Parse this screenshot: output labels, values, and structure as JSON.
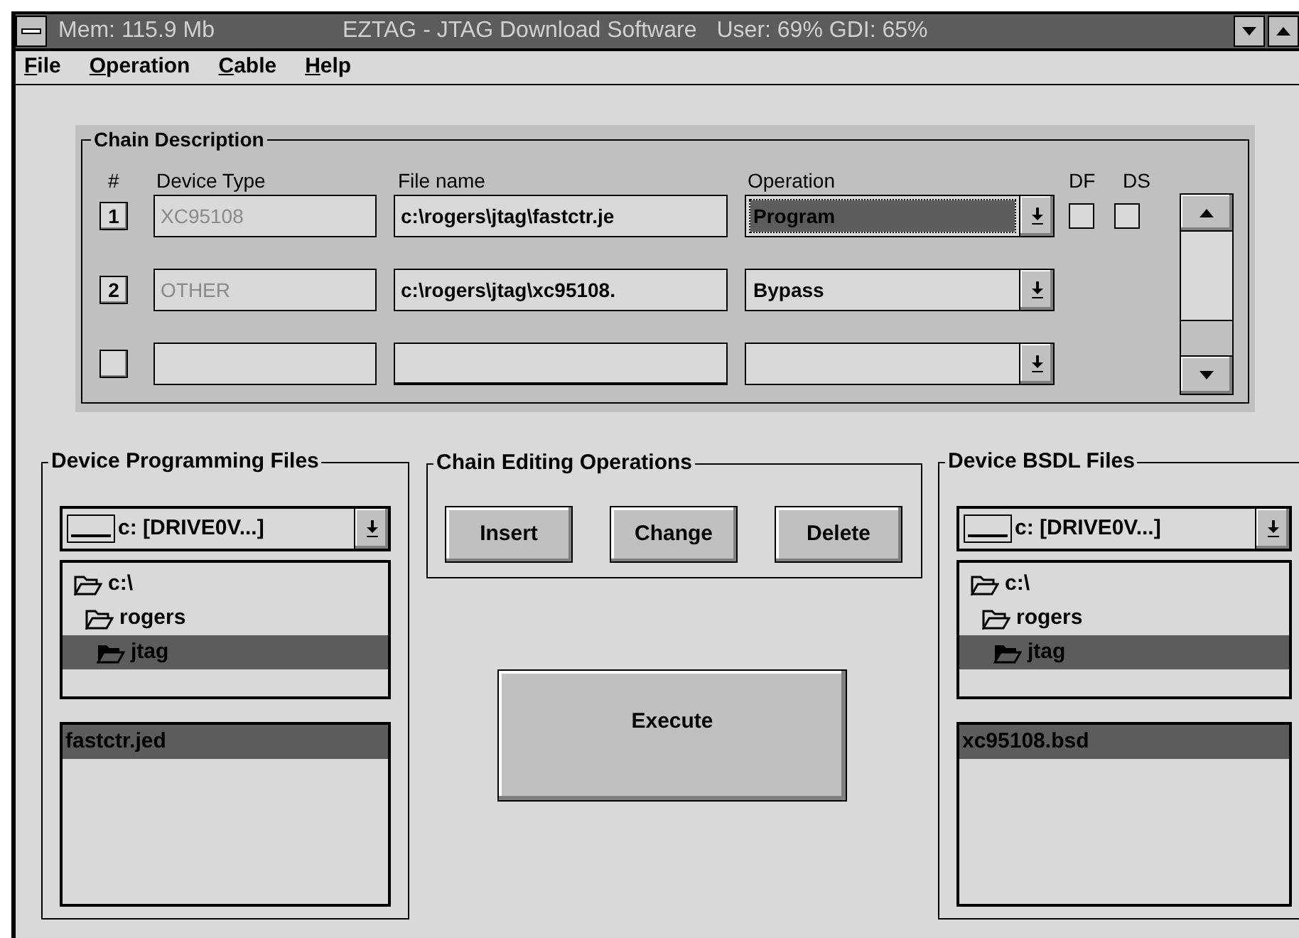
{
  "window": {
    "memory": "Mem: 115.9 Mb",
    "title": "EZTAG - JTAG Download Software",
    "resources": "User: 69% GDI: 65%"
  },
  "menu": [
    {
      "label": "File"
    },
    {
      "label": "Operation"
    },
    {
      "label": "Cable"
    },
    {
      "label": "Help"
    }
  ],
  "chain_description": {
    "title": "Chain Description",
    "columns": {
      "number": "#",
      "device_type": "Device Type",
      "file_name": "File name",
      "operation": "Operation",
      "df": "DF",
      "ds": "DS"
    },
    "rows": [
      {
        "number": "1",
        "device_type": "XC95108",
        "file_name": "c:\\rogers\\jtag\\fastctr.je",
        "operation": "Program",
        "selected": true,
        "df_checked": false,
        "ds_checked": false
      },
      {
        "number": "2",
        "device_type": "OTHER",
        "file_name": "c:\\rogers\\jtag\\xc95108.",
        "operation": "Bypass",
        "selected": false
      },
      {
        "selected": false
      }
    ]
  },
  "programming_files": {
    "title": "Device Programming Files",
    "drive": "c: [DRIVE0V...]",
    "folders": [
      {
        "label": "c:\\",
        "selected": false,
        "children": [
          {
            "label": "rogers",
            "selected": false,
            "children": [
              {
                "label": "jtag",
                "selected": true
              }
            ]
          }
        ]
      }
    ],
    "files": [
      {
        "label": "fastctr.jed",
        "selected": true
      }
    ]
  },
  "chain_editing": {
    "title": "Chain Editing Operations",
    "buttons": [
      "Insert",
      "Change",
      "Delete"
    ]
  },
  "execute_button": "Execute",
  "bsdl_files": {
    "title": "Device BSDL Files",
    "drive": "c: [DRIVE0V...]",
    "folders": [
      {
        "label": "c:\\",
        "selected": false,
        "children": [
          {
            "label": "rogers",
            "selected": false,
            "children": [
              {
                "label": "jtag",
                "selected": true
              }
            ]
          }
        ]
      }
    ],
    "files": [
      {
        "label": "xc95108.bsd",
        "selected": true
      }
    ]
  }
}
